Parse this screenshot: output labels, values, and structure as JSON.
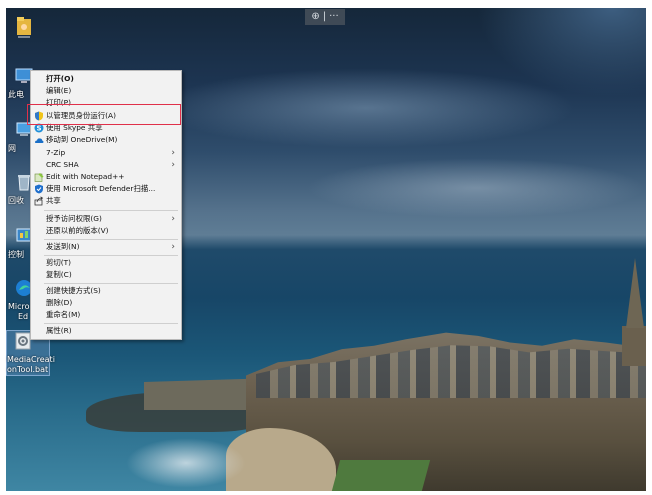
{
  "toolbar": {
    "zoom_icon": "⊕",
    "divider": "|",
    "more": "···"
  },
  "desktop_icons": [
    {
      "label": "此电"
    },
    {
      "label": "网"
    },
    {
      "label": "回收"
    },
    {
      "label": "控制"
    },
    {
      "label1": "Micro",
      "label2": "Ed"
    },
    {
      "label1": "MediaCreati",
      "label2": "onTool.bat"
    }
  ],
  "menu": {
    "items": [
      {
        "label": "打开(O)"
      },
      {
        "label": "编辑(E)"
      },
      {
        "label": "打印(P)"
      },
      {
        "label": "以管理员身份运行(A)"
      },
      {
        "label": "使用 Skype 共享"
      },
      {
        "label": "移动到 OneDrive(M)"
      },
      {
        "label": "7-Zip"
      },
      {
        "label": "CRC SHA"
      },
      {
        "label": "Edit with Notepad++"
      },
      {
        "label": "使用 Microsoft Defender扫描..."
      },
      {
        "label": "共享"
      },
      {
        "label": "授予访问权限(G)"
      },
      {
        "label": "还原以前的版本(V)"
      },
      {
        "label": "发送到(N)"
      },
      {
        "label": "剪切(T)"
      },
      {
        "label": "复制(C)"
      },
      {
        "label": "创建快捷方式(S)"
      },
      {
        "label": "删除(D)"
      },
      {
        "label": "重命名(M)"
      },
      {
        "label": "属性(R)"
      }
    ],
    "arrow": "›"
  },
  "colors": {
    "highlight_border": "#e0304a",
    "menu_bg": "#f2f2f2"
  }
}
